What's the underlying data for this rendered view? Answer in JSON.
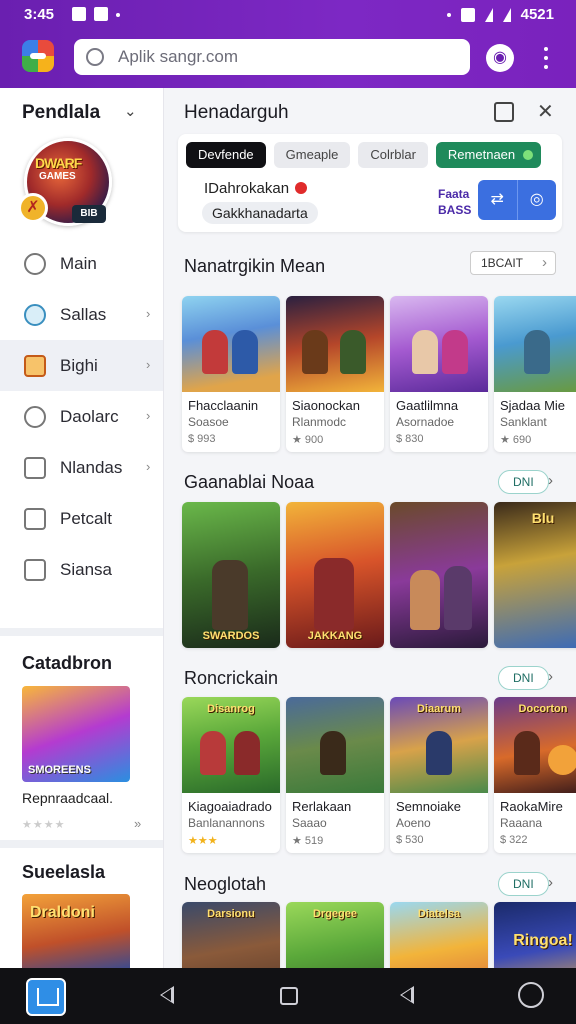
{
  "status": {
    "time": "3:45",
    "battery": "4521"
  },
  "search": {
    "value": "Aplik sangr.com"
  },
  "sidebar": {
    "header": "Pendlala",
    "avatar_title": "DWARF",
    "avatar_sub": "GAMES",
    "avatar_pill": "BIB",
    "items": [
      {
        "label": "Main"
      },
      {
        "label": "Sallas"
      },
      {
        "label": "Bighi"
      },
      {
        "label": "Daolarc"
      },
      {
        "label": "Nlandas"
      },
      {
        "label": "Petcalt"
      },
      {
        "label": "Siansa"
      }
    ],
    "section1": {
      "title": "Catadbron",
      "card_label": "SMOREENS",
      "card_name": "Repnraadcaal.",
      "stars": "★★★★"
    },
    "section2": {
      "title": "Sueelasla",
      "card_label": "Draldoni"
    }
  },
  "main": {
    "title": "Henadarguh",
    "chips": [
      "Devfende",
      "Gmeaple",
      "Colrblar",
      "Remetnaen"
    ],
    "filter_line1": "IDahrokakan",
    "filter_line2": "Gakkhanadarta",
    "filter_side1": "Faata",
    "filter_side2": "BASS",
    "sections": [
      {
        "title": "Nanatrgikin Mean",
        "button": "1BCAIT",
        "cards": [
          {
            "name": "Fhacclaanin",
            "sub": "Soasoe",
            "rating": "$ 993"
          },
          {
            "name": "Siaonockan",
            "sub": "Rlanmodc",
            "rating": "★ 900"
          },
          {
            "name": "Gaatlilmna",
            "sub": "Asornadoe",
            "rating": "$ 830"
          },
          {
            "name": "Sjadaa Mie",
            "sub": "Sanklant",
            "rating": "★ 690"
          }
        ]
      },
      {
        "title": "Gaanablai Noaa",
        "button": "DNI",
        "cards": [
          {
            "label": "SWARDOS"
          },
          {
            "label": "JAKKANG"
          },
          {
            "label": ""
          },
          {
            "label": "Blu"
          }
        ]
      },
      {
        "title": "Roncrickain",
        "button": "DNI",
        "cards": [
          {
            "label": "Disanrog",
            "name": "Kiagoaiadrado",
            "sub": "Banlanannons",
            "rating": "★★★"
          },
          {
            "label": "",
            "name": "Rerlakaan",
            "sub": "Saaao",
            "rating": "★ 519"
          },
          {
            "label": "Diaarum",
            "name": "Semnoiake",
            "sub": "Aoeno",
            "rating": "$ 530"
          },
          {
            "label": "Docorton",
            "name": "RaokaMire",
            "sub": "Raaana",
            "rating": "$ 322"
          }
        ]
      },
      {
        "title": "Neoglotah",
        "button": "DNI",
        "cards": [
          {
            "label": "Darsionu"
          },
          {
            "label": "Drgegee"
          },
          {
            "label": "Diatelsa"
          },
          {
            "label": "Ringoa!"
          }
        ]
      }
    ]
  },
  "colors": {
    "app_bar": "#7a22bd",
    "accent_green": "#1f8a5b",
    "accent_blue": "#3b6fe0"
  }
}
